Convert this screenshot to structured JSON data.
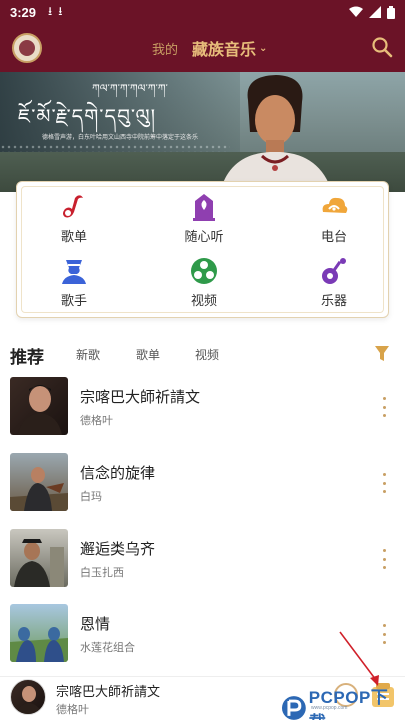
{
  "status_bar": {
    "time": "3:29",
    "download_icons": [
      "download-icon",
      "download-icon"
    ],
    "right_icons": [
      "wifi-icon",
      "signal-icon",
      "battery-icon"
    ]
  },
  "header": {
    "tab_mine": "我的",
    "tab_music": "藏族音乐",
    "avatar_icon": "avatar-icon",
    "search_icon": "search-icon"
  },
  "banner": {
    "title": "ཇོ་མོ་རྗེ་དགེ་དབུ་ལུ།",
    "title_top": "ཀལ་ཀ་ཀ་ཀལ་ཀ་ཀ་",
    "subtitle": "德格雪声游，白东叶哈用文山西寺中院前筹中落定于这条乐"
  },
  "categories": [
    {
      "label": "歌单",
      "icon": "playlist-icon",
      "color": "#c8202e"
    },
    {
      "label": "随心听",
      "icon": "shrine-icon",
      "color": "#8f3fb0"
    },
    {
      "label": "电台",
      "icon": "cloud-icon",
      "color": "#f0a63a"
    },
    {
      "label": "歌手",
      "icon": "singer-icon",
      "color": "#3b63d8"
    },
    {
      "label": "视频",
      "icon": "video-icon",
      "color": "#2f9a4a"
    },
    {
      "label": "乐器",
      "icon": "instrument-icon",
      "color": "#7a3ab6"
    }
  ],
  "rec_tabs": {
    "active": "推荐",
    "items": [
      "新歌",
      "歌单",
      "视频"
    ],
    "filter_icon": "filter-icon"
  },
  "songs": [
    {
      "title": "宗喀巴大師祈請文",
      "artist": "德格叶"
    },
    {
      "title": "信念的旋律",
      "artist": "白玛"
    },
    {
      "title": "邂逅类乌齐",
      "artist": "白玉扎西"
    },
    {
      "title": "恩情",
      "artist": "水莲花组合"
    }
  ],
  "player": {
    "title": "宗喀巴大師祈請文",
    "artist": "德格叶",
    "play_icon": "play-icon",
    "playlist_icon": "playlist-icon"
  },
  "watermark": {
    "text": "PCPOP下载",
    "sub": "www.pcpop.com"
  },
  "colors": {
    "brand": "#6b1327",
    "gold": "#c89f64",
    "tab_gold": "#e7bd7b"
  }
}
